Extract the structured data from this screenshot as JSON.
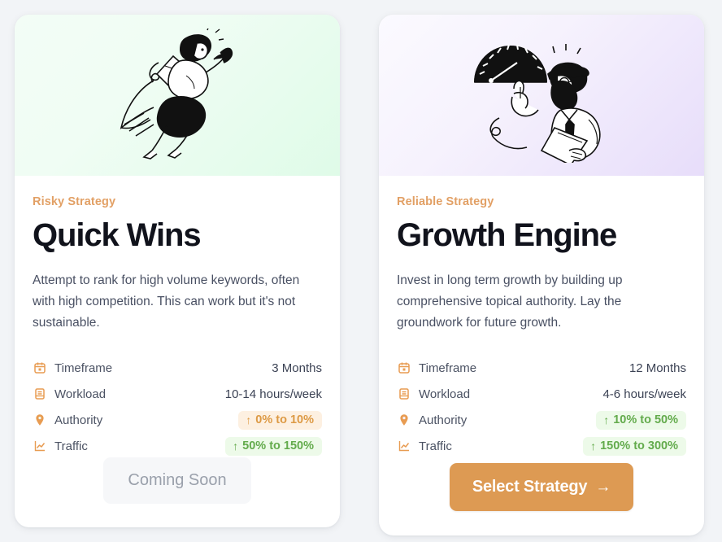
{
  "cards": [
    {
      "id": "quick-wins",
      "eyebrow": "Risky Strategy",
      "title": "Quick Wins",
      "description": "Attempt to rank for high volume keywords, often with high competition. This can work but it's not sustainable.",
      "illustration": "flying-person-rocket-illustration",
      "hero_gradient": "#f0fdf4",
      "stats": [
        {
          "icon": "calendar-icon",
          "label": "Timeframe",
          "value": "3 Months",
          "style": "plain"
        },
        {
          "icon": "book-icon",
          "label": "Workload",
          "value": "10-14 hours/week",
          "style": "plain"
        },
        {
          "icon": "map-pin-icon",
          "label": "Authority",
          "value": "0% to 10%",
          "arrow": "↑",
          "style": "orange"
        },
        {
          "icon": "line-chart-icon",
          "label": "Traffic",
          "value": "50% to 150%",
          "arrow": "↑",
          "style": "green"
        }
      ],
      "cta": {
        "label": "Coming Soon",
        "style": "disabled",
        "arrow": ""
      }
    },
    {
      "id": "growth-engine",
      "eyebrow": "Reliable Strategy",
      "title": "Growth Engine",
      "description": "Invest in long term growth by building up comprehensive topical authority. Lay the groundwork for future growth.",
      "illustration": "man-with-gauge-illustration",
      "hero_gradient": "#f3eefd",
      "stats": [
        {
          "icon": "calendar-icon",
          "label": "Timeframe",
          "value": "12 Months",
          "style": "plain"
        },
        {
          "icon": "book-icon",
          "label": "Workload",
          "value": "4-6 hours/week",
          "style": "plain"
        },
        {
          "icon": "map-pin-icon",
          "label": "Authority",
          "value": "10% to 50%",
          "arrow": "↑",
          "style": "green"
        },
        {
          "icon": "line-chart-icon",
          "label": "Traffic",
          "value": "150% to 300%",
          "arrow": "↑",
          "style": "green"
        }
      ],
      "cta": {
        "label": "Select Strategy",
        "style": "primary",
        "arrow": "→"
      }
    }
  ],
  "colors": {
    "page_background": "#f2f4f7",
    "eyebrow": "#e2a065",
    "title": "#11131c",
    "body_text": "#495063",
    "icon_orange": "#e89c52",
    "badge_orange_bg": "#fdf0e1",
    "badge_orange_text": "#dd9a45",
    "badge_green_bg": "#edfae9",
    "badge_green_text": "#63ab4c",
    "primary_button": "#dd9a53",
    "disabled_button_bg": "#f6f7f9",
    "disabled_button_text": "#9aa0ab"
  }
}
